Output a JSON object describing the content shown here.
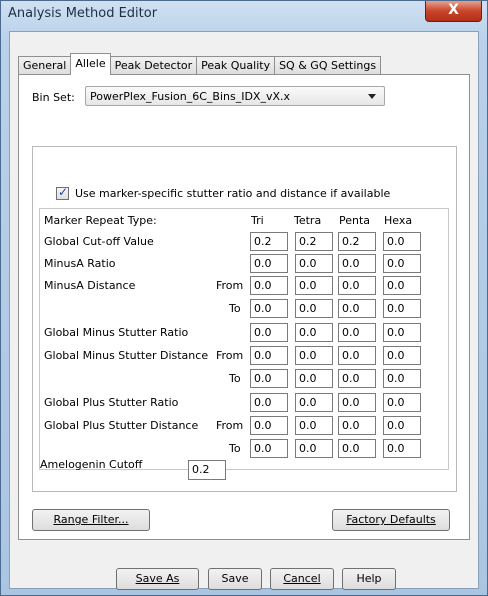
{
  "window": {
    "title": "Analysis Method Editor",
    "close_glyph": "X"
  },
  "tabs": [
    {
      "label": "General",
      "active": false
    },
    {
      "label": "Allele",
      "active": true
    },
    {
      "label": "Peak Detector",
      "active": false
    },
    {
      "label": "Peak Quality",
      "active": false
    },
    {
      "label": "SQ & GQ Settings",
      "active": false
    }
  ],
  "binset": {
    "label": "Bin Set:",
    "value": "PowerPlex_Fusion_6C_Bins_IDX_vX.x"
  },
  "stutter_checkbox": {
    "checked": true,
    "check_glyph": "✓",
    "label": "Use marker-specific stutter ratio and distance if available"
  },
  "table": {
    "header_label": "Marker Repeat Type:",
    "columns": [
      "Tri",
      "Tetra",
      "Penta",
      "Hexa"
    ],
    "rows": {
      "global_cutoff": {
        "label": "Global Cut-off Value",
        "values": [
          "0.2",
          "0.2",
          "0.2",
          "0.0"
        ]
      },
      "minusa_ratio": {
        "label": "MinusA Ratio",
        "values": [
          "0.0",
          "0.0",
          "0.0",
          "0.0"
        ]
      },
      "minusa_distance_from": {
        "label": "MinusA Distance",
        "sub": "From",
        "values": [
          "0.0",
          "0.0",
          "0.0",
          "0.0"
        ]
      },
      "minusa_distance_to": {
        "sub": "To",
        "values": [
          "0.0",
          "0.0",
          "0.0",
          "0.0"
        ]
      },
      "global_minus_ratio": {
        "label": "Global Minus Stutter Ratio",
        "values": [
          "0.0",
          "0.0",
          "0.0",
          "0.0"
        ]
      },
      "global_minus_distance_from": {
        "label": "Global Minus Stutter Distance",
        "sub": "From",
        "values": [
          "0.0",
          "0.0",
          "0.0",
          "0.0"
        ]
      },
      "global_minus_distance_to": {
        "sub": "To",
        "values": [
          "0.0",
          "0.0",
          "0.0",
          "0.0"
        ]
      },
      "global_plus_ratio": {
        "label": "Global Plus Stutter Ratio",
        "values": [
          "0.0",
          "0.0",
          "0.0",
          "0.0"
        ]
      },
      "global_plus_distance_from": {
        "label": "Global Plus Stutter Distance",
        "sub": "From",
        "values": [
          "0.0",
          "0.0",
          "0.0",
          "0.0"
        ]
      },
      "global_plus_distance_to": {
        "sub": "To",
        "values": [
          "0.0",
          "0.0",
          "0.0",
          "0.0"
        ]
      }
    }
  },
  "amelogenin": {
    "label": "Amelogenin Cutoff",
    "value": "0.2"
  },
  "buttons": {
    "range_filter": "Range Filter...",
    "factory_defaults": "Factory Defaults",
    "save_as": "Save As",
    "save": "Save",
    "cancel": "Cancel",
    "help": "Help"
  },
  "colors": {
    "title_bar": "#b9d1ea",
    "close_button": "#c8462b",
    "panel_bg": "#f0f0f0"
  }
}
